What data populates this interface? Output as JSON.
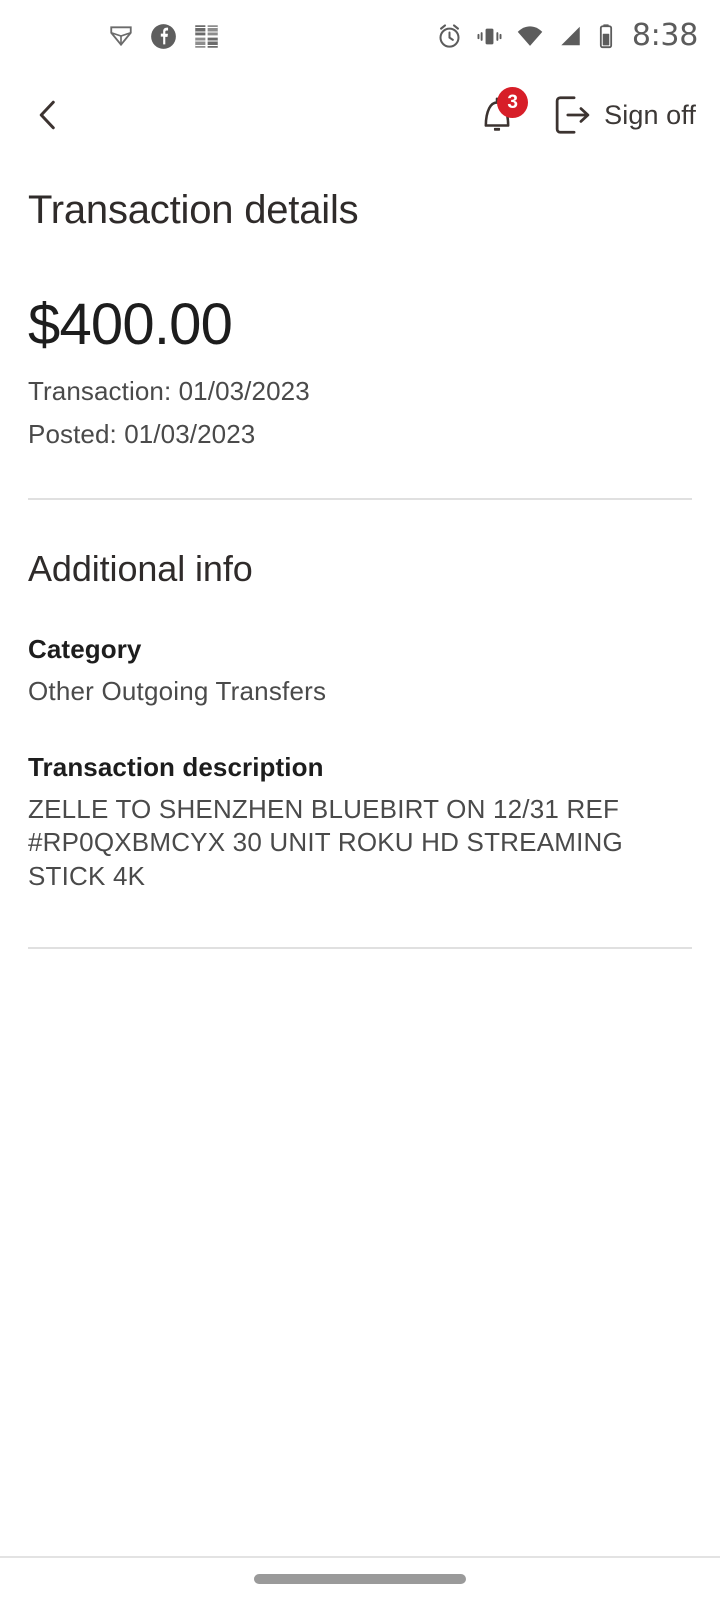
{
  "status_bar": {
    "time": "8:38",
    "left_icons": [
      {
        "name": "app-notification-shield-icon"
      },
      {
        "name": "facebook-notification-icon"
      },
      {
        "name": "app-notification-squares-icon"
      }
    ],
    "right_icons": [
      {
        "name": "alarm-clock-icon"
      },
      {
        "name": "vibrate-mode-icon"
      },
      {
        "name": "wifi-icon"
      },
      {
        "name": "cellular-signal-icon"
      },
      {
        "name": "battery-icon"
      }
    ]
  },
  "nav_bar": {
    "back_label": "Back",
    "notification_count": "3",
    "sign_off_label": "Sign off"
  },
  "header": {
    "title": "Transaction details"
  },
  "transaction": {
    "amount": "$400.00",
    "transaction_date": "Transaction: 01/03/2023",
    "posted_date": "Posted: 01/03/2023"
  },
  "additional_info": {
    "title": "Additional info",
    "fields": [
      {
        "label": "Category",
        "value": "Other Outgoing Transfers"
      },
      {
        "label": "Transaction description",
        "value": "ZELLE TO SHENZHEN BLUEBIRT ON 12/31 REF #RP0QXBMCYX 30 UNIT ROKU HD STREAMING STICK 4K"
      }
    ]
  },
  "colors": {
    "badge_red": "#d71e28",
    "text_primary": "#2f2b2a",
    "text_secondary": "#4a4a4a",
    "divider": "#e0e0e0"
  }
}
